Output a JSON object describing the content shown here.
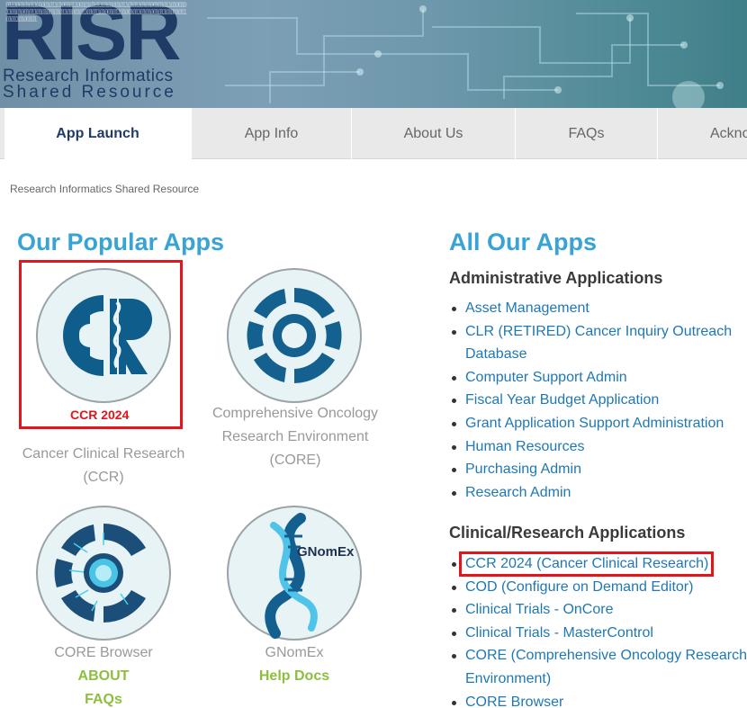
{
  "banner": {
    "logo_word": "RISR",
    "logo_line1": "Research Informatics",
    "logo_line2": "Shared Resource",
    "binary": "0111001010110100101101001011001010101101010010110101101010010101101001011010100101101010010101101001011010110100101101001011010100101101001011010110100101"
  },
  "nav": {
    "tabs": [
      {
        "label": "App Launch"
      },
      {
        "label": "App Info"
      },
      {
        "label": "About Us"
      },
      {
        "label": "FAQs"
      },
      {
        "label": "Ackno"
      }
    ]
  },
  "breadcrumb": "Research Informatics Shared Resource",
  "popular": {
    "heading": "Our Popular Apps",
    "ccr_label": "CCR 2024",
    "ccr_caption": "Cancer Clinical Research (CCR)",
    "core_caption": "Comprehensive Oncology Research Environment (CORE)",
    "core_browser_caption": "CORE Browser",
    "core_browser_about": "ABOUT",
    "core_browser_faqs": "FAQs",
    "gnomex_caption": "GNomEx",
    "gnomex_help": "Help Docs",
    "gnomex_logo": "GNomEx"
  },
  "all_apps": {
    "heading": "All Our Apps",
    "admin_heading": "Administrative Applications",
    "admin": [
      "Asset Management",
      "CLR (RETIRED) Cancer Inquiry Outreach Database",
      "Computer Support Admin",
      "Fiscal Year Budget Application",
      "Grant Application Support Administration",
      "Human Resources",
      "Purchasing Admin",
      "Research Admin"
    ],
    "clinical_heading": "Clinical/Research Applications",
    "clinical": [
      "CCR 2024 (Cancer Clinical Research)",
      "COD (Configure on Demand Editor)",
      "Clinical Trials - OnCore",
      "Clinical Trials - MasterControl",
      "CORE (Comprehensive Oncology Research Environment)",
      "CORE Browser"
    ]
  },
  "colors": {
    "heading_blue": "#3aa3d6",
    "link_blue": "#1f78b4",
    "navy": "#1f3b66",
    "highlight_red": "#e2141c",
    "link_green": "#8dbf3f"
  }
}
